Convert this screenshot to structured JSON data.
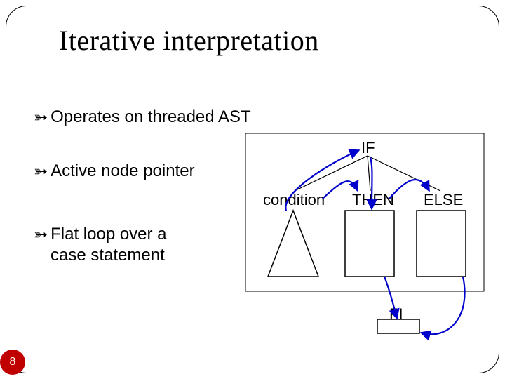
{
  "title": "Iterative interpretation",
  "bullets": {
    "b1": "Operates on threaded AST",
    "b2": "Active node pointer",
    "b3a": "Flat loop over a",
    "b3b": "case statement"
  },
  "nodes": {
    "root": "IF",
    "cond": "condition",
    "then": "THEN",
    "else": "ELSE",
    "fi": "FI"
  },
  "page": "8",
  "colors": {
    "pointer": "#0000cc",
    "accent": "#c00000"
  }
}
